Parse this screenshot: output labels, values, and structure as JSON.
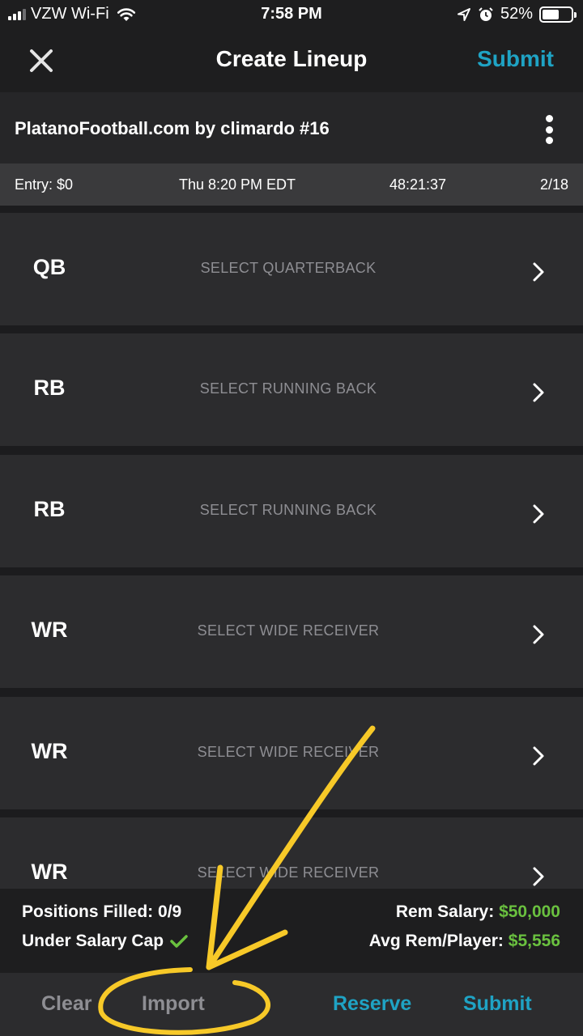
{
  "status_bar": {
    "carrier": "VZW Wi-Fi",
    "time": "7:58 PM",
    "battery": "52%"
  },
  "nav": {
    "title": "Create Lineup",
    "submit_label": "Submit"
  },
  "contest": {
    "name": "PlatanoFootball.com by climardo #16"
  },
  "info": {
    "entry": "Entry: $0",
    "start": "Thu 8:20 PM EDT",
    "countdown": "48:21:37",
    "entries": "2/18"
  },
  "positions": [
    {
      "pos": "QB",
      "prompt": "SELECT QUARTERBACK"
    },
    {
      "pos": "RB",
      "prompt": "SELECT RUNNING BACK"
    },
    {
      "pos": "RB",
      "prompt": "SELECT RUNNING BACK"
    },
    {
      "pos": "WR",
      "prompt": "SELECT WIDE RECEIVER"
    },
    {
      "pos": "WR",
      "prompt": "SELECT WIDE RECEIVER"
    },
    {
      "pos": "WR",
      "prompt": "SELECT WIDE RECEIVER"
    }
  ],
  "summary": {
    "positions_filled": "Positions Filled: 0/9",
    "salary_cap": "Under Salary Cap",
    "rem_salary_label": "Rem Salary:",
    "rem_salary_value": "$50,000",
    "avg_label": "Avg Rem/Player:",
    "avg_value": "$5,556"
  },
  "toolbar": {
    "clear": "Clear",
    "import": "Import",
    "reserve": "Reserve",
    "submit": "Submit"
  },
  "colors": {
    "accent": "#1fa3c4",
    "success": "#6ac13f",
    "annotation": "#f7c928"
  }
}
